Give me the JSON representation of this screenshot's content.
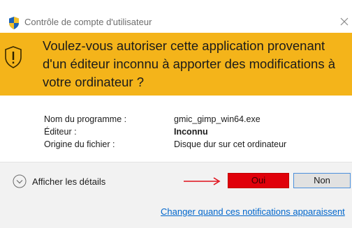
{
  "window": {
    "title": "Contrôle de compte d'utilisateur",
    "title_icon": "shield-icon",
    "close_icon": "close-icon"
  },
  "banner": {
    "color": "#f4b41a",
    "icon": "warning-shield-icon",
    "question": "Voulez-vous autoriser cette application provenant d'un éditeur inconnu à apporter des modifications à votre ordinateur ?"
  },
  "details": {
    "program_label": "Nom du programme :",
    "program_value": "gmic_gimp_win64.exe",
    "publisher_label": "Éditeur :",
    "publisher_value": "Inconnu",
    "origin_label": "Origine du fichier :",
    "origin_value": "Disque dur sur cet ordinateur"
  },
  "footer": {
    "show_details_label": "Afficher les détails",
    "show_details_icon": "chevron-down-icon",
    "yes_label": "Oui",
    "no_label": "Non",
    "annotation_arrow": "red-arrow-icon",
    "yes_highlight_color": "#e0000a",
    "notification_link": "Changer quand ces notifications apparaissent"
  }
}
